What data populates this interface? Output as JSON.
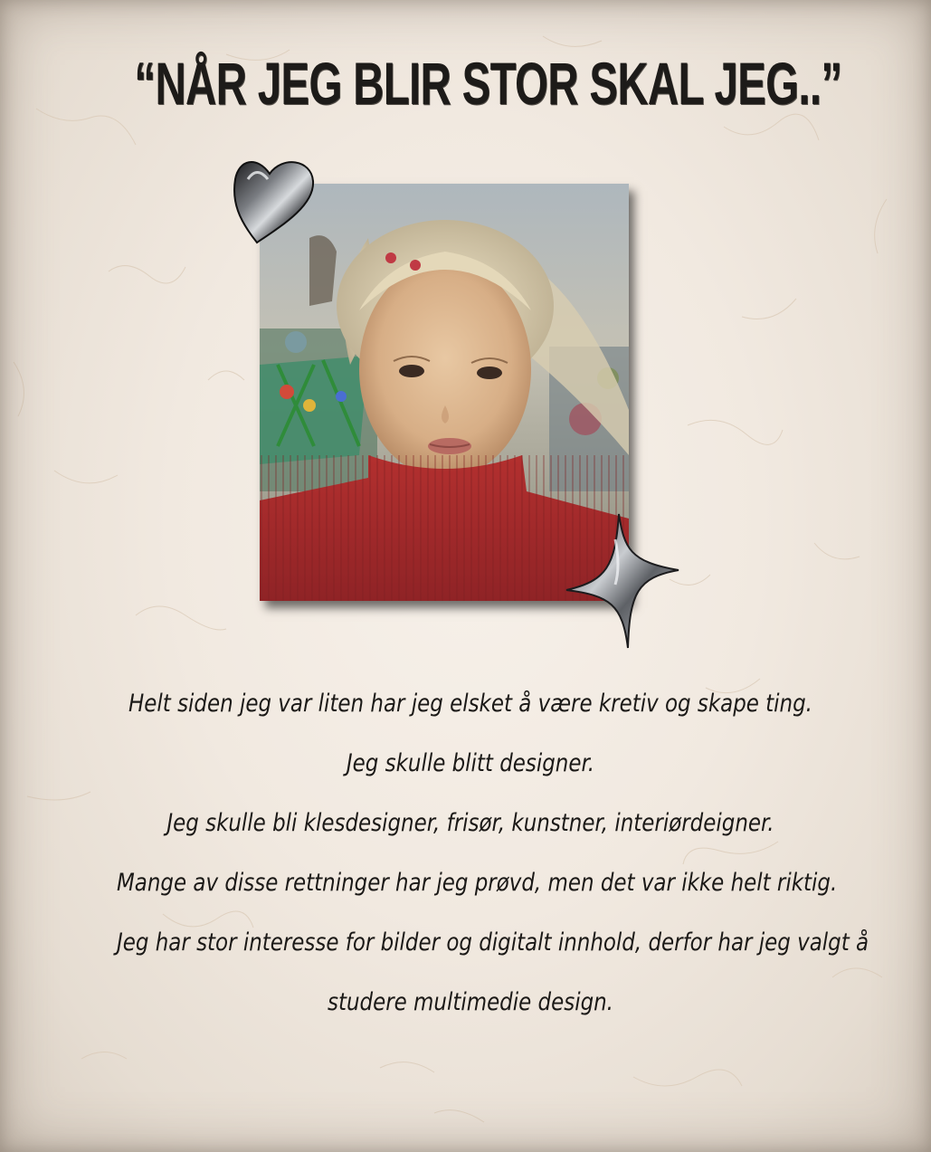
{
  "title": "“NÅR JEG BLIR STOR SKAL JEG..”",
  "photo": {
    "description_icon": "child-portrait-photo"
  },
  "decorations": {
    "heart": "heart-icon",
    "star": "star-icon"
  },
  "paragraphs": [
    "Helt siden jeg var liten har jeg elsket å være kretiv og skape ting.",
    "Jeg skulle blitt designer.",
    "Jeg skulle bli klesdesigner, frisør, kunstner, interiørdeigner.",
    "Mange av disse rettninger har jeg prøvd, men det var ikke helt riktig.",
    "Jeg har stor interesse for bilder og digitalt innhold, derfor har jeg valgt å",
    "studere multimedie design."
  ],
  "colors": {
    "paper": "#f1e9e0",
    "text": "#1b1917",
    "sweater": "#a32a2c"
  }
}
